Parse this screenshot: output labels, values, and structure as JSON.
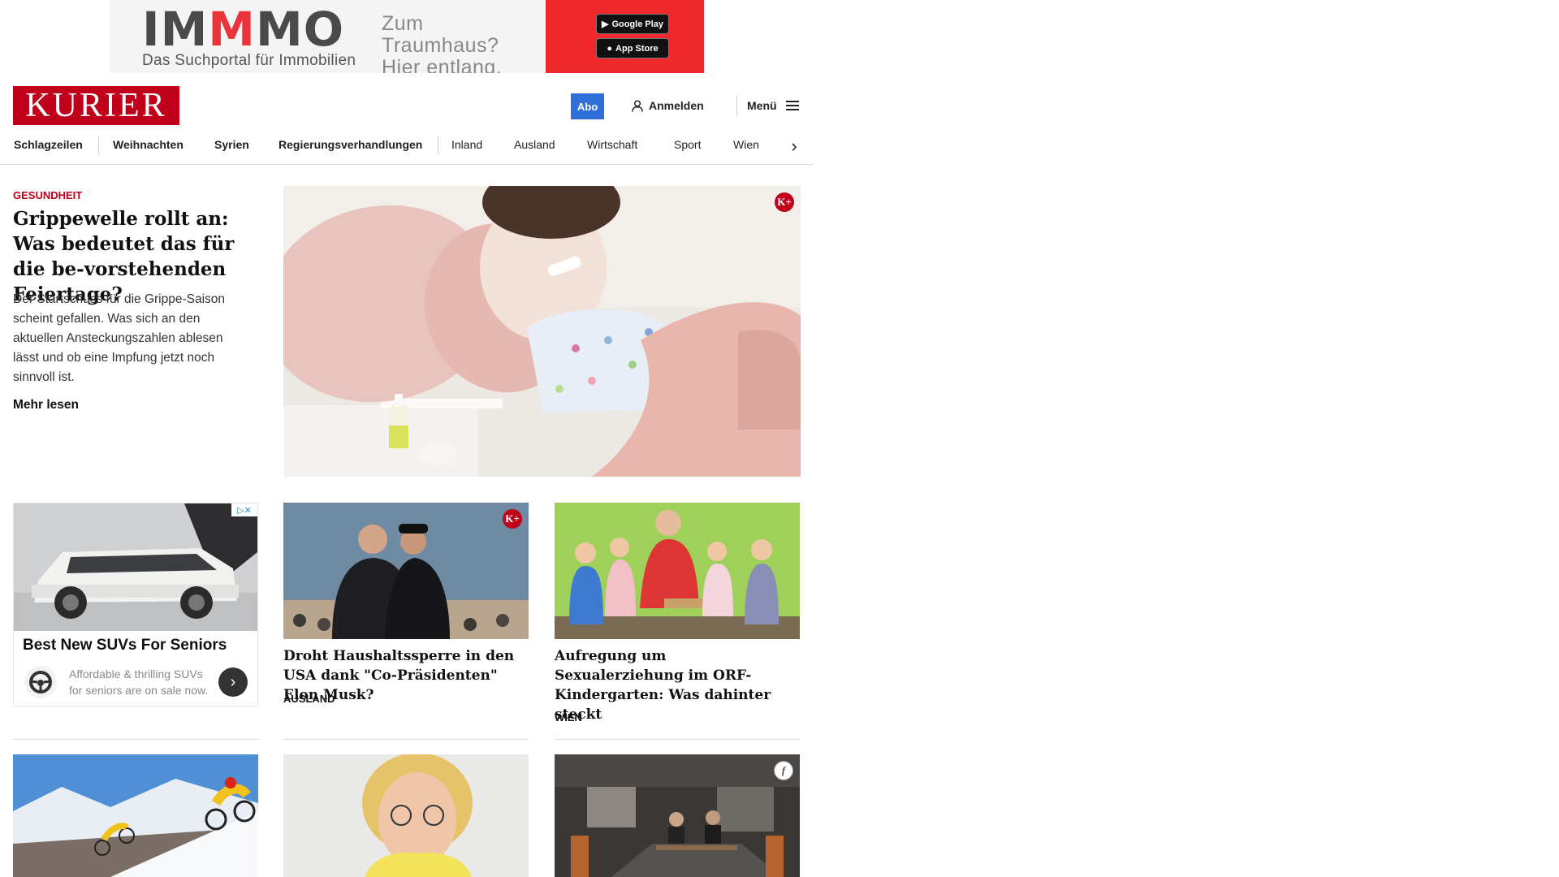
{
  "ad_banner": {
    "brand_prefix": "IM",
    "brand_highlight": "M",
    "brand_suffix": "MO",
    "subline": "Das Suchportal für Immobilien",
    "claim": "Zum Traumhaus?\nHier entlang.",
    "google_play": "Google Play",
    "app_store": "App Store",
    "colors": {
      "accent": "#f0282d",
      "brand_text": "#4a4a4a"
    }
  },
  "header": {
    "logo": "KURIER",
    "abo_label": "Abo",
    "login_label": "Anmelden",
    "menu_label": "Menü",
    "colors": {
      "brand": "#c0001b",
      "abo": "#2f6fd9"
    }
  },
  "nav": {
    "items": [
      "Schlagzeilen",
      "Weihnachten",
      "Syrien",
      "Regierungsverhandlungen",
      "Inland",
      "Ausland",
      "Wirtschaft",
      "Sport",
      "Wien"
    ],
    "next_icon": "chevron-right-icon"
  },
  "hero": {
    "kicker": "GESUNDHEIT",
    "title": "Grippewelle rollt an: Was bedeutet das für die be-vorstehenden Feiertage?",
    "teaser": "Der Startschuss für die Grippe-Saison scheint gefallen. Was sich an den aktuellen Ansteckungszahlen ablesen lässt und ob eine Impfung jetzt noch sinnvoll ist.",
    "more_label": "Mehr lesen",
    "badge": "K+"
  },
  "ad_card": {
    "title": "Best New SUVs For Seniors",
    "text": "Affordable & thrilling SUVs for seniors are on sale now.",
    "flag": "▷✕"
  },
  "articles": [
    {
      "title": "Droht Haushaltssperre in den USA dank \"Co-Präsidenten\" Elon Musk?",
      "kicker": "AUSLAND",
      "badge": "K+"
    },
    {
      "title": "Aufregung um Sexualerziehung im ORF-Kindergarten: Was dahinter steckt",
      "kicker": "WIEN"
    }
  ],
  "bottom_badge": "f"
}
